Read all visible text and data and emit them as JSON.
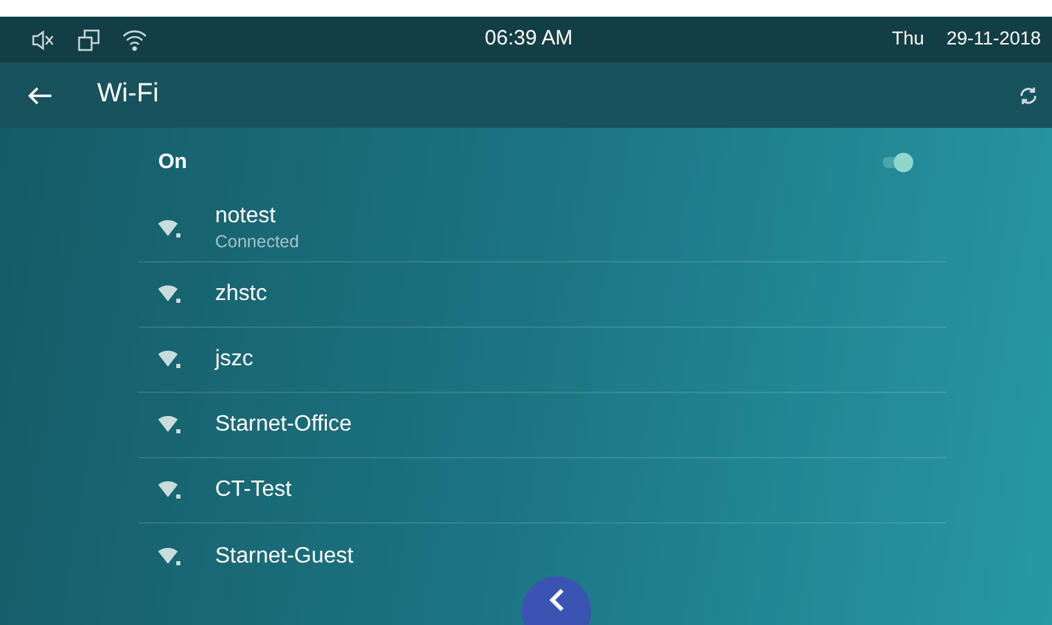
{
  "status_bar": {
    "time": "06:39 AM",
    "day": "Thu",
    "date": "29-11-2018"
  },
  "app_bar": {
    "title": "Wi-Fi"
  },
  "wifi_switch": {
    "label": "On",
    "on": true
  },
  "networks": [
    {
      "name": "notest",
      "status": "Connected"
    },
    {
      "name": "zhstc"
    },
    {
      "name": "jszc"
    },
    {
      "name": "Starnet-Office"
    },
    {
      "name": "CT-Test"
    },
    {
      "name": "Starnet-Guest"
    }
  ]
}
